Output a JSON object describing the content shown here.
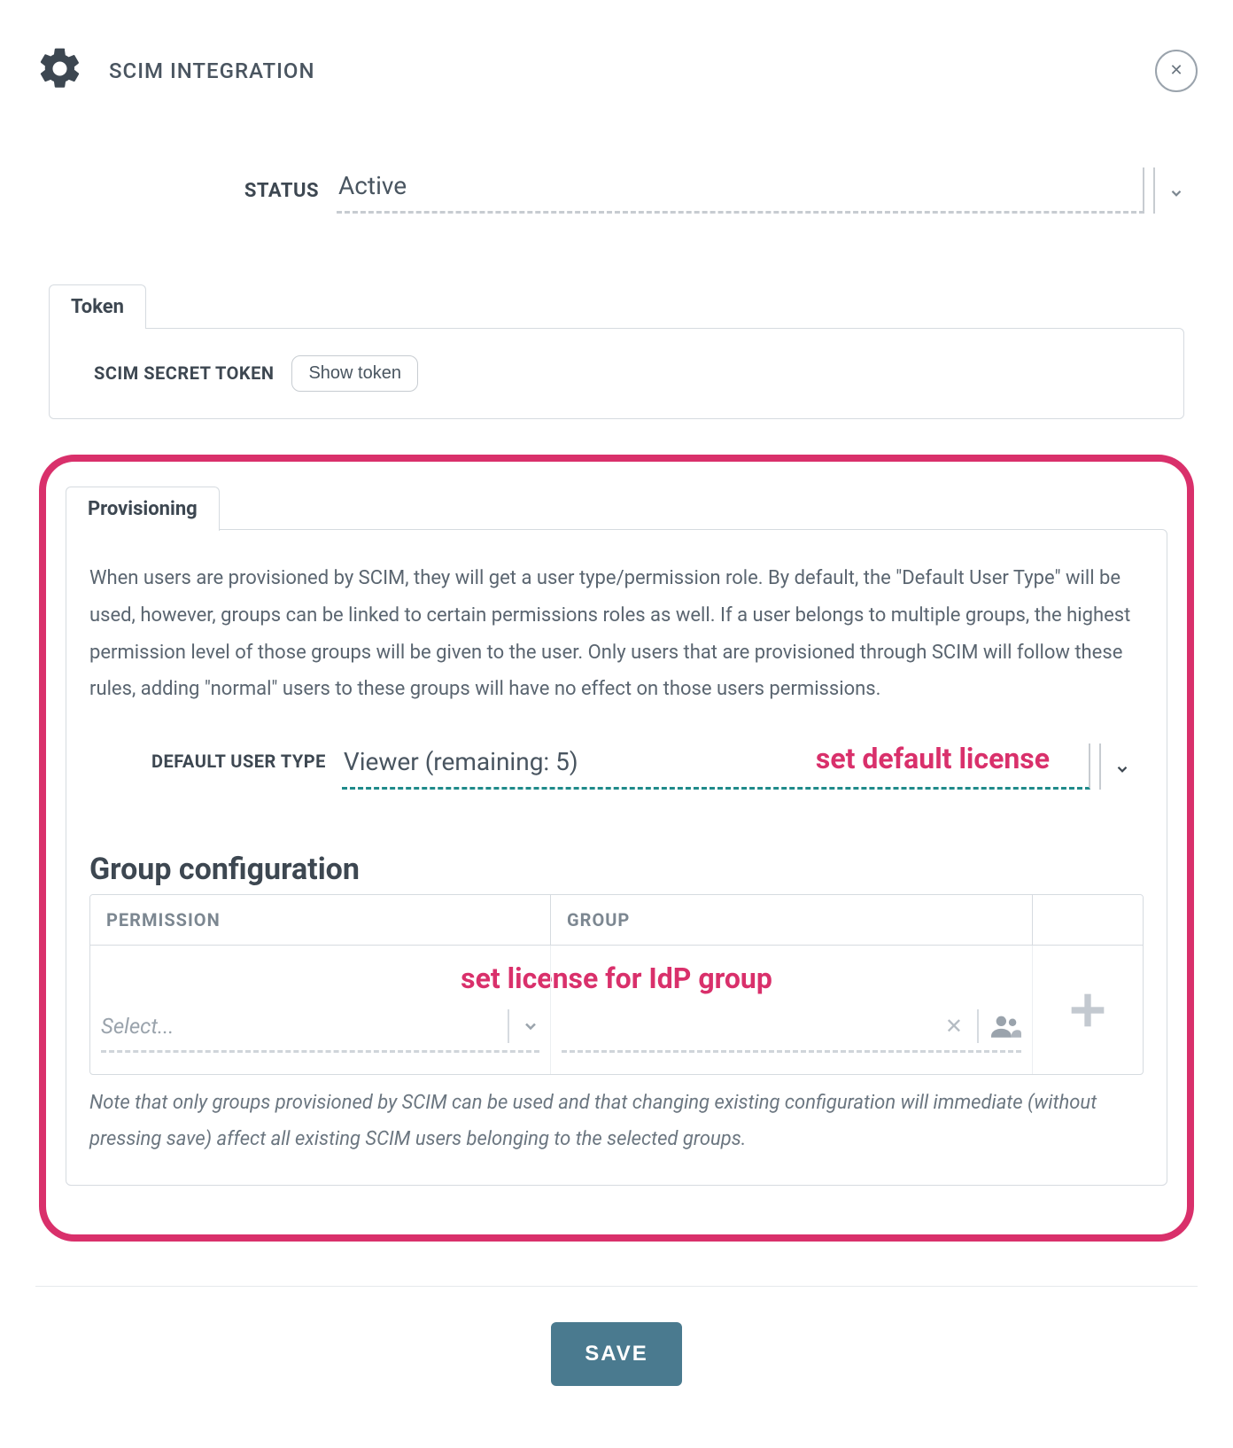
{
  "header": {
    "title": "SCIM INTEGRATION"
  },
  "status": {
    "label": "STATUS",
    "value": "Active"
  },
  "token": {
    "tab_label": "Token",
    "secret_label": "SCIM SECRET TOKEN",
    "show_button": "Show token"
  },
  "provisioning": {
    "tab_label": "Provisioning",
    "description": "When users are provisioned by SCIM, they will get a user type/permission role. By default, the \"Default User Type\" will be used, however, groups can be linked to certain permissions roles as well. If a user belongs to multiple groups, the highest permission level of those groups will be given to the user. Only users that are provisioned through SCIM will follow these rules, adding \"normal\" users to these groups will have no effect on those users permissions.",
    "default_user_type_label": "DEFAULT USER TYPE",
    "default_user_type_value": "Viewer (remaining: 5)",
    "group_config_heading": "Group configuration",
    "columns": {
      "permission": "PERMISSION",
      "group": "GROUP"
    },
    "permission_placeholder": "Select...",
    "note": "Note that only groups provisioned by SCIM can be used and that changing existing configuration will immediate (without pressing save) affect all existing SCIM users belonging to the selected groups."
  },
  "annotations": {
    "default_license": "set default license",
    "idp_group": "set license for IdP group"
  },
  "footer": {
    "save": "SAVE"
  }
}
